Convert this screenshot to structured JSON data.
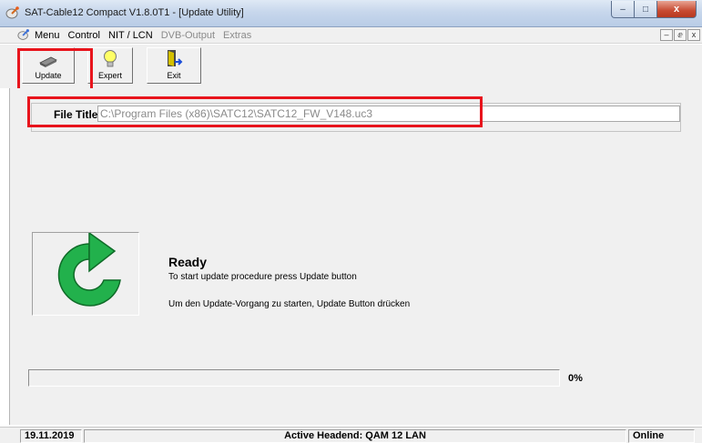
{
  "window": {
    "title": "SAT-Cable12 Compact V1.8.0T1 - [Update Utility]",
    "minimize_glyph": "–",
    "maximize_glyph": "□",
    "close_glyph": "x"
  },
  "menu": {
    "items": [
      {
        "label": "Menu",
        "enabled": true
      },
      {
        "label": "Control",
        "enabled": true
      },
      {
        "label": "NIT / LCN",
        "enabled": true
      },
      {
        "label": "DVB-Output",
        "enabled": false
      },
      {
        "label": "Extras",
        "enabled": false
      }
    ],
    "mdi_minimize": "–",
    "mdi_restore": "ⅇ",
    "mdi_close": "x"
  },
  "toolbar": {
    "update_label": "Update",
    "expert_label": "Expert",
    "exit_label": "Exit"
  },
  "file": {
    "label": "File Title:",
    "value": "C:\\Program Files (x86)\\SATC12\\SATC12_FW_V148.uc3"
  },
  "status": {
    "title": "Ready",
    "message_en": "To start update procedure press Update button",
    "message_de": "Um den Update-Vorgang zu starten, Update Button drücken"
  },
  "progress": {
    "percent_label": "0%",
    "value_fraction": 0
  },
  "statusbar": {
    "date": "19.11.2019",
    "headend": "Active Headend: QAM 12 LAN",
    "connection": "Online"
  },
  "colors": {
    "highlight": "#e8141c",
    "refresh_icon": "#22b14c",
    "progress_fill": "#2ea53a"
  },
  "icons": {
    "app": "satellite-dish-icon",
    "update": "chip-icon",
    "expert": "lightbulb-icon",
    "exit": "door-exit-icon",
    "status": "refresh-arrow-icon"
  }
}
